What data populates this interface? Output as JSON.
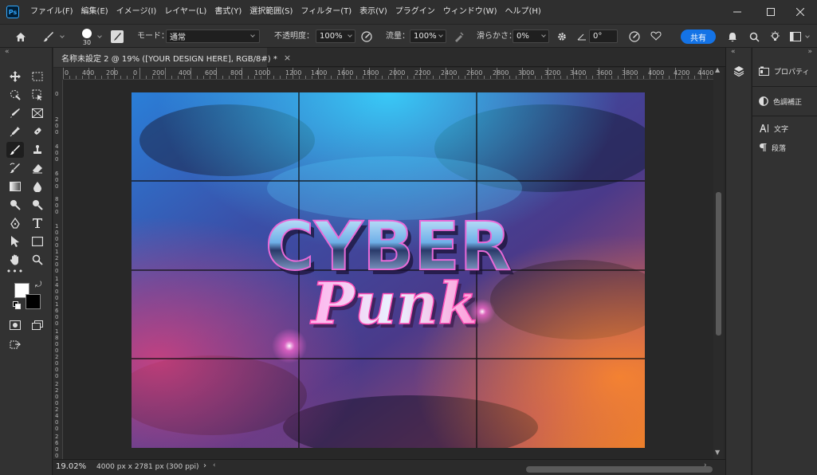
{
  "app": {
    "logo": "Ps",
    "accent": "#31a8ff"
  },
  "menu": [
    "ファイル(F)",
    "編集(E)",
    "イメージ(I)",
    "レイヤー(L)",
    "書式(Y)",
    "選択範囲(S)",
    "フィルター(T)",
    "表示(V)",
    "プラグイン",
    "ウィンドウ(W)",
    "ヘルプ(H)"
  ],
  "options": {
    "brush_size": "30",
    "mode_label": "モード：",
    "mode_value": "通常",
    "opacity_label": "不透明度：",
    "opacity_value": "100%",
    "flow_label": "流量：",
    "flow_value": "100%",
    "smoothing_label": "滑らかさ：",
    "smoothing_value": "0%",
    "angle_value": "0°",
    "share_label": "共有",
    "share_color": "#1473e6"
  },
  "document": {
    "tab_title": "名称未設定 2 @ 19% ([YOUR DESIGN HERE], RGB/8#) *",
    "close_glyph": "×"
  },
  "ruler_top": [
    "0",
    "400",
    "200",
    "0",
    "200",
    "400",
    "600",
    "800",
    "1000",
    "1200",
    "1400",
    "1600",
    "1800",
    "2000",
    "2200",
    "2400",
    "2600",
    "2800",
    "3000",
    "3200",
    "3400",
    "3600",
    "3800",
    "4000",
    "4200",
    "4400"
  ],
  "ruler_left": [
    "0",
    "200",
    "400",
    "600",
    "800",
    "1000",
    "1200",
    "1400",
    "1600",
    "1800",
    "2000",
    "2200",
    "2400",
    "2600"
  ],
  "artwork": {
    "line1": "CYBER",
    "line2": "Punk"
  },
  "status": {
    "zoom": "19.02%",
    "info": "4000 px x 2781 px (300 ppi)",
    "arrow": "›"
  },
  "panels": [
    {
      "label": "プロパティ",
      "icon": "properties-icon"
    },
    {
      "label": "色調補正",
      "icon": "adjustments-icon"
    },
    {
      "label": "文字",
      "icon": "character-icon"
    },
    {
      "label": "段落",
      "icon": "paragraph-icon"
    }
  ],
  "colors": {
    "foreground": "#ffffff",
    "background": "#000000"
  }
}
